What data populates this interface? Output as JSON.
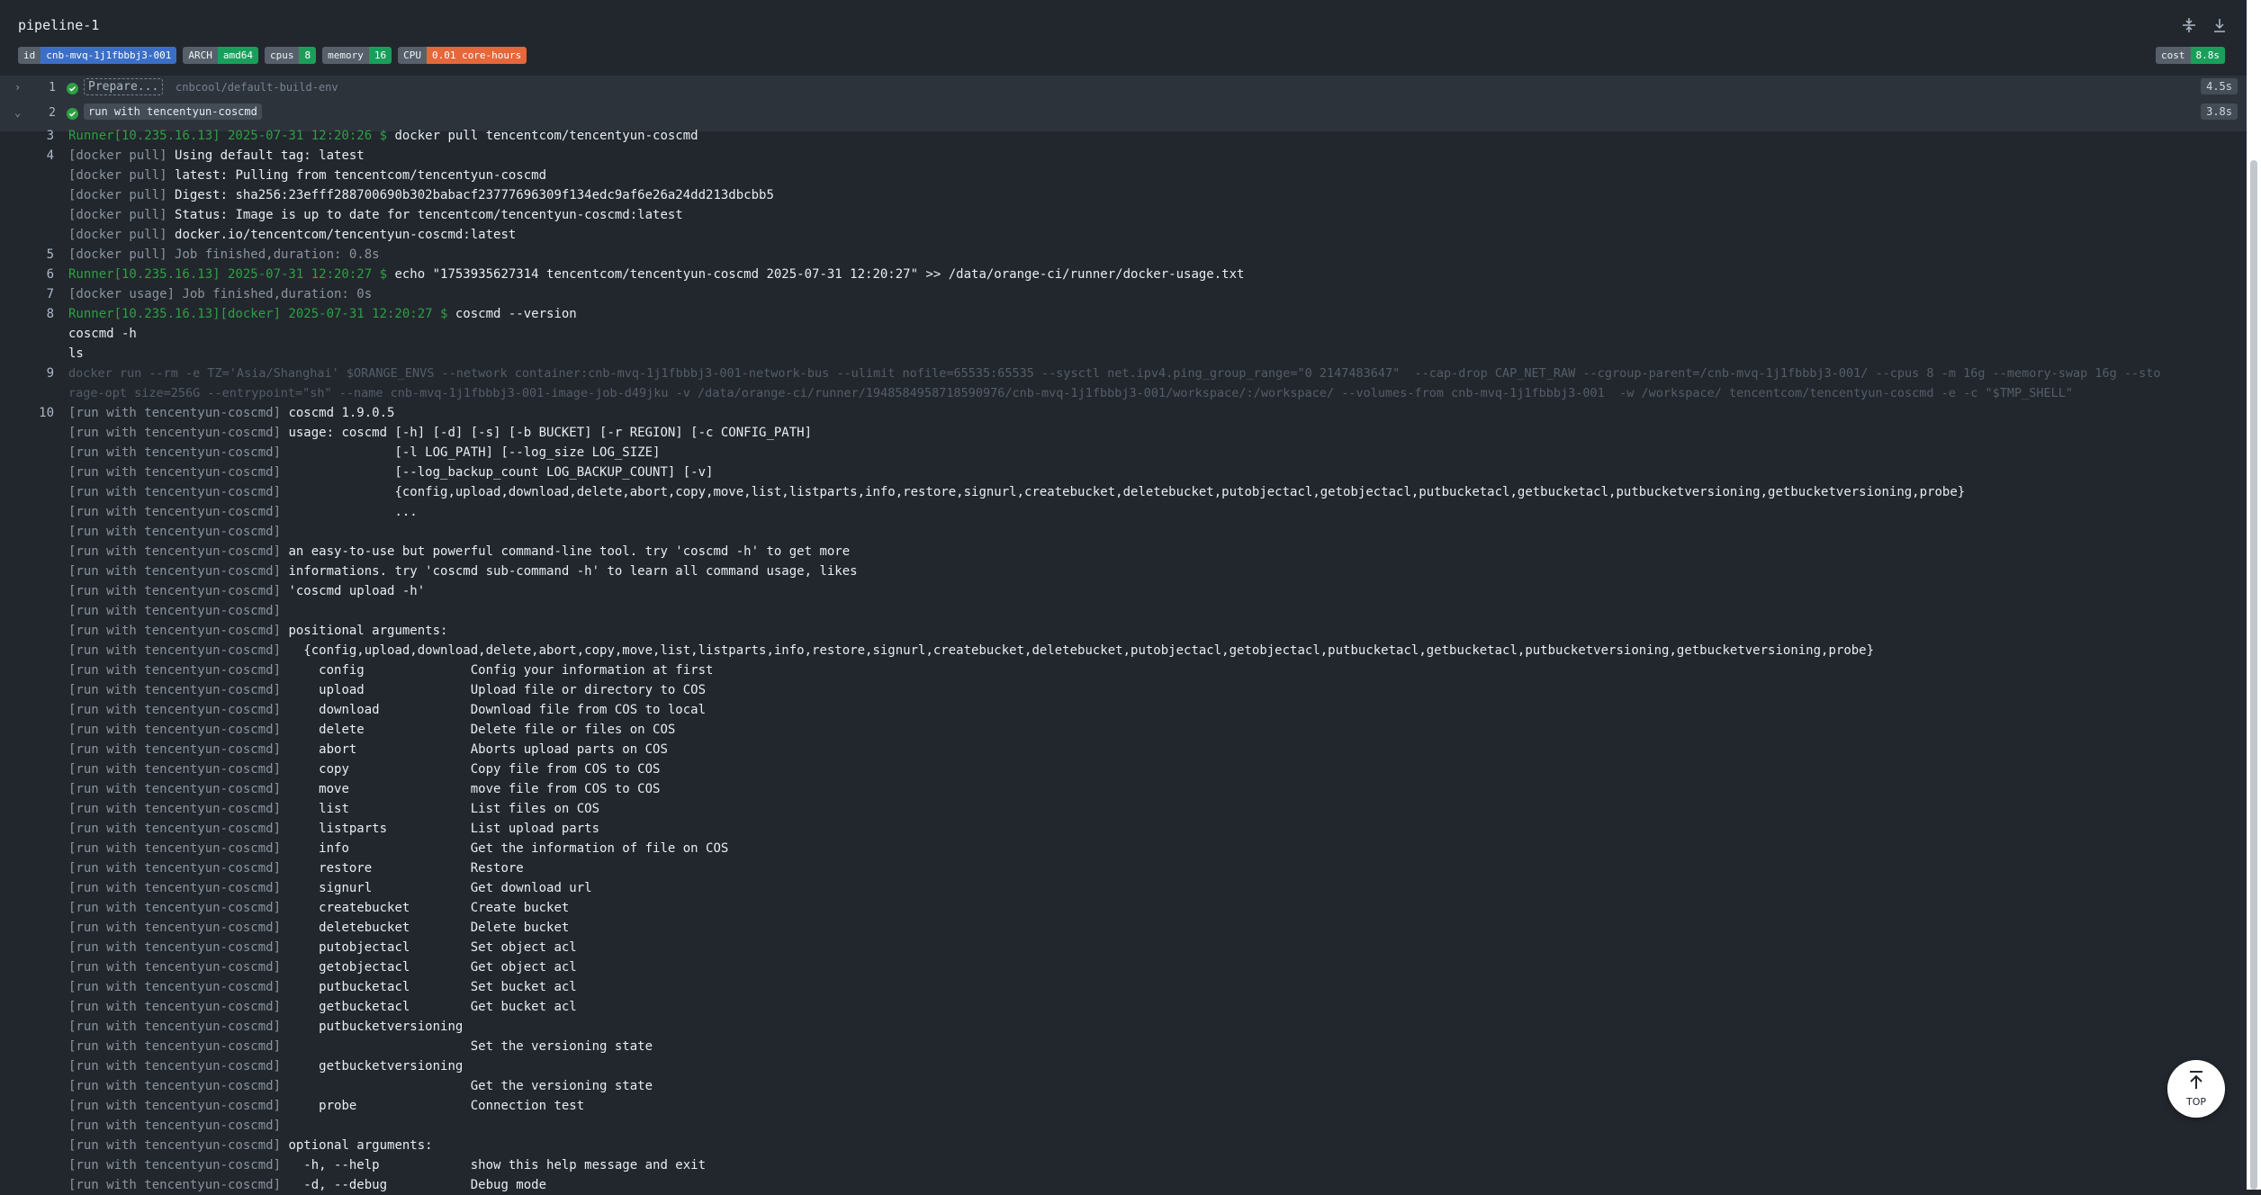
{
  "header": {
    "title": "pipeline-1",
    "badges": [
      {
        "key": "id",
        "value": "cnb-mvq-1j1fbbbj3-001",
        "color": "#3b6fc7"
      },
      {
        "key": "ARCH",
        "value": "amd64",
        "color": "#1a9f5b"
      },
      {
        "key": "cpus",
        "value": "8",
        "color": "#1a9f5b"
      },
      {
        "key": "memory",
        "value": "16",
        "color": "#1a9f5b"
      },
      {
        "key": "CPU",
        "value": "0.01 core-hours",
        "color": "#e5673a"
      }
    ],
    "cost": {
      "key": "cost",
      "value": "8.8s",
      "color": "#1a9f5b"
    }
  },
  "steps": [
    {
      "number": "1",
      "name": "Prepare...",
      "image": "cnbcool/default-build-env",
      "duration": "4.5s",
      "chevron": "chevron-right-icon"
    },
    {
      "number": "2",
      "name": "run with tencentyun-coscmd",
      "duration": "3.8s",
      "chevron": "chevron-down-icon"
    }
  ],
  "log": [
    {
      "no": "3",
      "prefix": "Runner[10.235.16.13] 2025-07-31 12:20:26 $ ",
      "text": "docker pull tencentcom/tencentyun-coscmd"
    },
    {
      "no": "4",
      "prefix": "[docker pull] ",
      "text": "Using default tag: latest"
    },
    {
      "no": "",
      "prefix": "[docker pull] ",
      "text": "latest: Pulling from tencentcom/tencentyun-coscmd"
    },
    {
      "no": "",
      "prefix": "[docker pull] ",
      "text": "Digest: sha256:23efff288700690b302babacf23777696309f134edc9af6e26a24dd213dbcbb5"
    },
    {
      "no": "",
      "prefix": "[docker pull] ",
      "text": "Status: Image is up to date for tencentcom/tencentyun-coscmd:latest"
    },
    {
      "no": "",
      "prefix": "[docker pull] ",
      "text": "docker.io/tencentcom/tencentyun-coscmd:latest"
    },
    {
      "no": "5",
      "prefix": "[docker pull] Job finished,duration: 0.8s",
      "text": ""
    },
    {
      "no": "6",
      "prefix": "Runner[10.235.16.13] 2025-07-31 12:20:27 $ ",
      "text": "echo \"1753935627314 tencentcom/tencentyun-coscmd 2025-07-31 12:20:27\" >> /data/orange-ci/runner/docker-usage.txt"
    },
    {
      "no": "7",
      "prefix": "[docker usage] Job finished,duration: 0s",
      "text": ""
    },
    {
      "no": "8",
      "prefix": "Runner[10.235.16.13][docker] 2025-07-31 12:20:27 $ ",
      "text": "coscmd --version"
    },
    {
      "no": "",
      "prefix": "",
      "text": "coscmd -h"
    },
    {
      "no": "",
      "prefix": "",
      "text": "ls"
    },
    {
      "no": "9",
      "faint": "docker run --rm -e TZ='Asia/Shanghai' $ORANGE_ENVS --network container:cnb-mvq-1j1fbbbj3-001-network-bus --ulimit nofile=65535:65535 --sysctl net.ipv4.ping_group_range=\"0 2147483647\"  --cap-drop CAP_NET_RAW --cgroup-parent=/cnb-mvq-1j1fbbbj3-001/ --cpus 8 -m 16g --memory-swap 16g --sto"
    },
    {
      "no": "",
      "faint": "rage-opt size=256G --entrypoint=\"sh\" --name cnb-mvq-1j1fbbbj3-001-image-job-d49jku -v /data/orange-ci/runner/1948584958718590976/cnb-mvq-1j1fbbbj3-001/workspace/:/workspace/ --volumes-from cnb-mvq-1j1fbbbj3-001  -w /workspace/ tencentcom/tencentyun-coscmd -e -c \"$TMP_SHELL\""
    },
    {
      "no": "10",
      "prefix": "[run with tencentyun-coscmd] ",
      "text": "coscmd 1.9.0.5"
    },
    {
      "no": "",
      "prefix": "[run with tencentyun-coscmd] ",
      "text": "usage: coscmd [-h] [-d] [-s] [-b BUCKET] [-r REGION] [-c CONFIG_PATH]"
    },
    {
      "no": "",
      "prefix": "[run with tencentyun-coscmd] ",
      "text": "              [-l LOG_PATH] [--log_size LOG_SIZE]"
    },
    {
      "no": "",
      "prefix": "[run with tencentyun-coscmd] ",
      "text": "              [--log_backup_count LOG_BACKUP_COUNT] [-v]"
    },
    {
      "no": "",
      "prefix": "[run with tencentyun-coscmd] ",
      "text": "              {config,upload,download,delete,abort,copy,move,list,listparts,info,restore,signurl,createbucket,deletebucket,putobjectacl,getobjectacl,putbucketacl,getbucketacl,putbucketversioning,getbucketversioning,probe}"
    },
    {
      "no": "",
      "prefix": "[run with tencentyun-coscmd] ",
      "text": "              ..."
    },
    {
      "no": "",
      "prefix": "[run with tencentyun-coscmd] ",
      "text": ""
    },
    {
      "no": "",
      "prefix": "[run with tencentyun-coscmd] ",
      "text": "an easy-to-use but powerful command-line tool. try 'coscmd -h' to get more"
    },
    {
      "no": "",
      "prefix": "[run with tencentyun-coscmd] ",
      "text": "informations. try 'coscmd sub-command -h' to learn all command usage, likes"
    },
    {
      "no": "",
      "prefix": "[run with tencentyun-coscmd] ",
      "text": "'coscmd upload -h'"
    },
    {
      "no": "",
      "prefix": "[run with tencentyun-coscmd] ",
      "text": ""
    },
    {
      "no": "",
      "prefix": "[run with tencentyun-coscmd] ",
      "text": "positional arguments:"
    },
    {
      "no": "",
      "prefix": "[run with tencentyun-coscmd] ",
      "text": "  {config,upload,download,delete,abort,copy,move,list,listparts,info,restore,signurl,createbucket,deletebucket,putobjectacl,getobjectacl,putbucketacl,getbucketacl,putbucketversioning,getbucketversioning,probe}"
    },
    {
      "no": "",
      "prefix": "[run with tencentyun-coscmd] ",
      "text": "    config              Config your information at first"
    },
    {
      "no": "",
      "prefix": "[run with tencentyun-coscmd] ",
      "text": "    upload              Upload file or directory to COS"
    },
    {
      "no": "",
      "prefix": "[run with tencentyun-coscmd] ",
      "text": "    download            Download file from COS to local"
    },
    {
      "no": "",
      "prefix": "[run with tencentyun-coscmd] ",
      "text": "    delete              Delete file or files on COS"
    },
    {
      "no": "",
      "prefix": "[run with tencentyun-coscmd] ",
      "text": "    abort               Aborts upload parts on COS"
    },
    {
      "no": "",
      "prefix": "[run with tencentyun-coscmd] ",
      "text": "    copy                Copy file from COS to COS"
    },
    {
      "no": "",
      "prefix": "[run with tencentyun-coscmd] ",
      "text": "    move                move file from COS to COS"
    },
    {
      "no": "",
      "prefix": "[run with tencentyun-coscmd] ",
      "text": "    list                List files on COS"
    },
    {
      "no": "",
      "prefix": "[run with tencentyun-coscmd] ",
      "text": "    listparts           List upload parts"
    },
    {
      "no": "",
      "prefix": "[run with tencentyun-coscmd] ",
      "text": "    info                Get the information of file on COS"
    },
    {
      "no": "",
      "prefix": "[run with tencentyun-coscmd] ",
      "text": "    restore             Restore"
    },
    {
      "no": "",
      "prefix": "[run with tencentyun-coscmd] ",
      "text": "    signurl             Get download url"
    },
    {
      "no": "",
      "prefix": "[run with tencentyun-coscmd] ",
      "text": "    createbucket        Create bucket"
    },
    {
      "no": "",
      "prefix": "[run with tencentyun-coscmd] ",
      "text": "    deletebucket        Delete bucket"
    },
    {
      "no": "",
      "prefix": "[run with tencentyun-coscmd] ",
      "text": "    putobjectacl        Set object acl"
    },
    {
      "no": "",
      "prefix": "[run with tencentyun-coscmd] ",
      "text": "    getobjectacl        Get object acl"
    },
    {
      "no": "",
      "prefix": "[run with tencentyun-coscmd] ",
      "text": "    putbucketacl        Set bucket acl"
    },
    {
      "no": "",
      "prefix": "[run with tencentyun-coscmd] ",
      "text": "    getbucketacl        Get bucket acl"
    },
    {
      "no": "",
      "prefix": "[run with tencentyun-coscmd] ",
      "text": "    putbucketversioning"
    },
    {
      "no": "",
      "prefix": "[run with tencentyun-coscmd] ",
      "text": "                        Set the versioning state"
    },
    {
      "no": "",
      "prefix": "[run with tencentyun-coscmd] ",
      "text": "    getbucketversioning"
    },
    {
      "no": "",
      "prefix": "[run with tencentyun-coscmd] ",
      "text": "                        Get the versioning state"
    },
    {
      "no": "",
      "prefix": "[run with tencentyun-coscmd] ",
      "text": "    probe               Connection test"
    },
    {
      "no": "",
      "prefix": "[run with tencentyun-coscmd] ",
      "text": ""
    },
    {
      "no": "",
      "prefix": "[run with tencentyun-coscmd] ",
      "text": "optional arguments:"
    },
    {
      "no": "",
      "prefix": "[run with tencentyun-coscmd] ",
      "text": "  -h, --help            show this help message and exit"
    },
    {
      "no": "",
      "prefix": "[run with tencentyun-coscmd] ",
      "text": "  -d, --debug           Debug mode"
    }
  ],
  "top_button": {
    "label": "TOP"
  },
  "icons": {
    "collapse": "collapse-icon",
    "download": "download-icon",
    "top": "arrow-up-icon"
  }
}
